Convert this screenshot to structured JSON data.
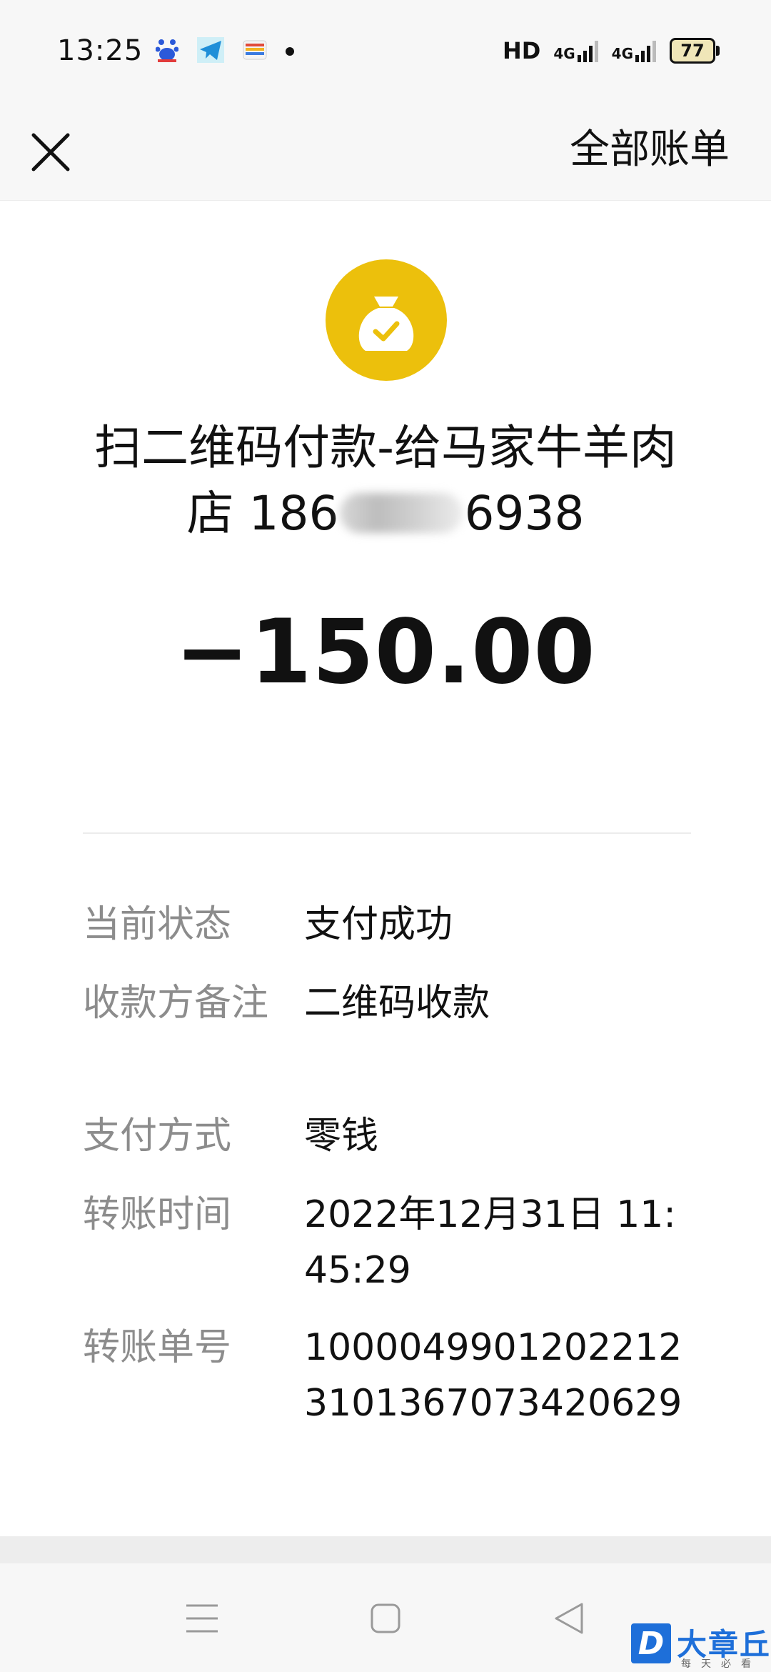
{
  "status_bar": {
    "time": "13:25",
    "network_label": "HD",
    "signal_1": "4G",
    "signal_2": "4G",
    "battery": "77",
    "left_icons": [
      "baidu-icon",
      "telegram-icon",
      "wallet-icon",
      "notification-dot-icon"
    ]
  },
  "header": {
    "close_icon": "close-icon",
    "all_bills_label": "全部账单"
  },
  "transaction": {
    "icon": "money-bag-check-icon",
    "icon_color": "#ecc00c",
    "title_line1": "扫二维码付款-给马家牛羊肉",
    "title_line2_prefix": "店 186",
    "title_line2_suffix": "6938",
    "amount": "−150.00"
  },
  "details": [
    {
      "label": "当前状态",
      "value": "支付成功"
    },
    {
      "label": "收款方备注",
      "value": "二维码收款"
    },
    {
      "label": "支付方式",
      "value": "零钱"
    },
    {
      "label": "转账时间",
      "value": "2022年12月31日 11:45:29"
    },
    {
      "label": "转账单号",
      "value": "10000499012022123101367073420629"
    }
  ],
  "nav": {
    "menu_icon": "menu-icon",
    "home_icon": "home-icon",
    "back_icon": "back-icon"
  },
  "watermark": {
    "letter": "D",
    "title": "大章丘",
    "subtitle": "每天必看",
    "color": "#1e6fd9"
  }
}
